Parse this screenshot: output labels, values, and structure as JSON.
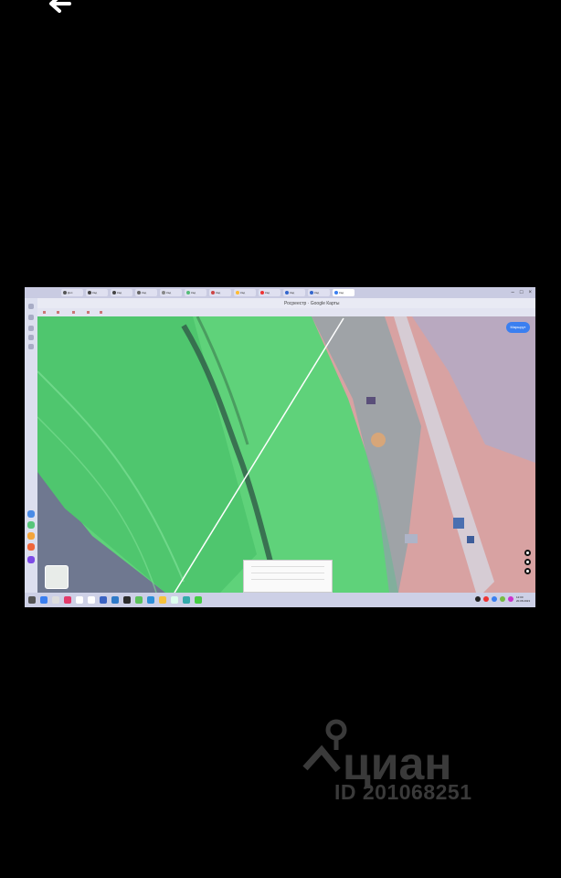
{
  "nav": {
    "back_icon": "arrow-left-icon"
  },
  "screenshot": {
    "browser": {
      "page_title": "Росреестр · Google Карты",
      "tab_labels": [
        "Доп",
        "Кад",
        "Кад",
        "Кад",
        "Кад",
        "Кад",
        "Кад",
        "Кад",
        "Кад",
        "Кад",
        "Кад",
        "Кад"
      ],
      "window_controls": [
        "–",
        "□",
        "×"
      ]
    },
    "map": {
      "route_button": "Маршрут",
      "colors": {
        "grass": "#5fd27a",
        "grass_dark": "#3fb95e",
        "water": "#6f7890",
        "soil": "#d08a86",
        "road": "#c9c2c8"
      }
    },
    "taskbar": {
      "clock": "12:00",
      "date": "20.08.2023"
    }
  },
  "watermark": {
    "brand": "циан",
    "id_text": "ID 201068251",
    "icon": "map-pin-logo"
  }
}
